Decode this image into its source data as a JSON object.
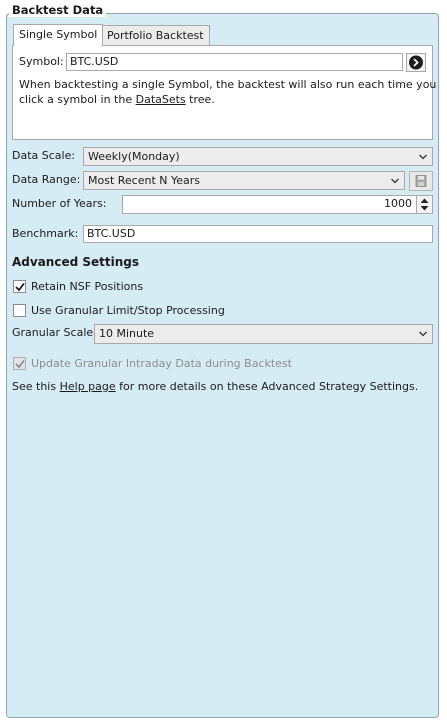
{
  "group": {
    "title": "Backtest Data"
  },
  "tabs": [
    {
      "label": "Single Symbol",
      "active": true
    },
    {
      "label": "Portfolio Backtest",
      "active": false
    }
  ],
  "single_symbol": {
    "symbol_label": "Symbol:",
    "symbol_value": "BTC.USD",
    "help_text_1": "When backtesting a single Symbol, the backtest will also run each time you",
    "help_text_2a": "click a symbol in the ",
    "help_text_link": "DataSets",
    "help_text_2b": " tree."
  },
  "data_scale": {
    "label": "Data Scale:",
    "value": "Weekly(Monday)"
  },
  "data_range": {
    "label": "Data Range:",
    "value": "Most Recent N Years"
  },
  "number_of_years": {
    "label": "Number of Years:",
    "value": "1000"
  },
  "benchmark": {
    "label": "Benchmark:",
    "value": "BTC.USD"
  },
  "advanced": {
    "heading": "Advanced Settings",
    "retain_nsf": {
      "label": "Retain NSF Positions",
      "checked": true
    },
    "use_granular": {
      "label": "Use Granular Limit/Stop Processing",
      "checked": false
    },
    "granular_scale": {
      "label": "Granular Scale",
      "value": "10 Minute"
    },
    "update_granular": {
      "label": "Update Granular Intraday Data during Backtest",
      "checked": true,
      "enabled": false
    },
    "footer_a": "See this ",
    "footer_link": "Help page",
    "footer_b": " for more details on these Advanced Strategy Settings."
  },
  "colors": {
    "panel_bg": "#d6ecf4",
    "border": "#8ea3b0"
  }
}
